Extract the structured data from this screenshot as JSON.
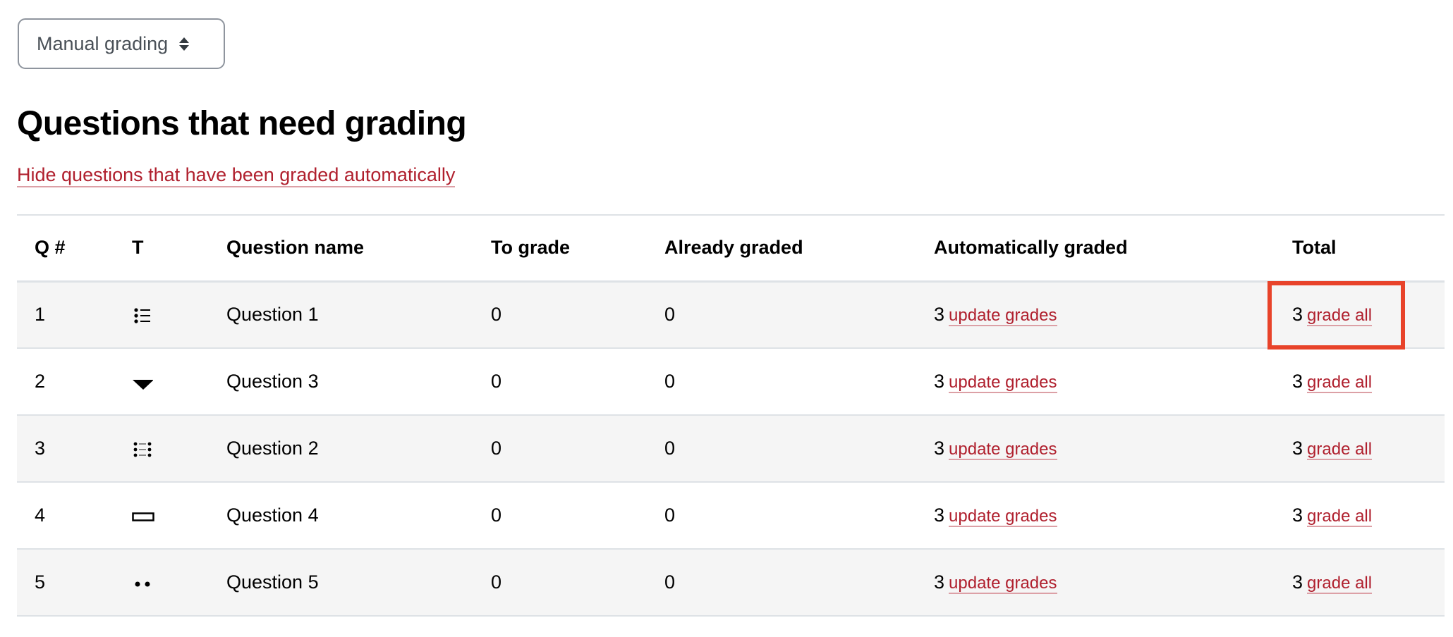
{
  "select": {
    "value": "Manual grading"
  },
  "heading": "Questions that need grading",
  "hide_link": "Hide questions that have been graded automatically",
  "table": {
    "headers": [
      "Q #",
      "T",
      "Question name",
      "To grade",
      "Already graded",
      "Automatically graded",
      "Total"
    ],
    "rows": [
      {
        "q": "1",
        "type_icon": "multiple-choice-icon",
        "name": "Question 1",
        "to_grade": "0",
        "already": "0",
        "auto": "3",
        "auto_link": "update grades",
        "total": "3",
        "total_link": "grade all",
        "highlighted": true
      },
      {
        "q": "2",
        "type_icon": "select-missing-words-icon",
        "name": "Question 3",
        "to_grade": "0",
        "already": "0",
        "auto": "3",
        "auto_link": "update grades",
        "total": "3",
        "total_link": "grade all"
      },
      {
        "q": "3",
        "type_icon": "matching-icon",
        "name": "Question 2",
        "to_grade": "0",
        "already": "0",
        "auto": "3",
        "auto_link": "update grades",
        "total": "3",
        "total_link": "grade all"
      },
      {
        "q": "4",
        "type_icon": "short-answer-icon",
        "name": "Question 4",
        "to_grade": "0",
        "already": "0",
        "auto": "3",
        "auto_link": "update grades",
        "total": "3",
        "total_link": "grade all"
      },
      {
        "q": "5",
        "type_icon": "true-false-icon",
        "name": "Question 5",
        "to_grade": "0",
        "already": "0",
        "auto": "3",
        "auto_link": "update grades",
        "total": "3",
        "total_link": "grade all"
      }
    ]
  },
  "colors": {
    "link": "#b0202e",
    "highlight": "#e8432a"
  }
}
